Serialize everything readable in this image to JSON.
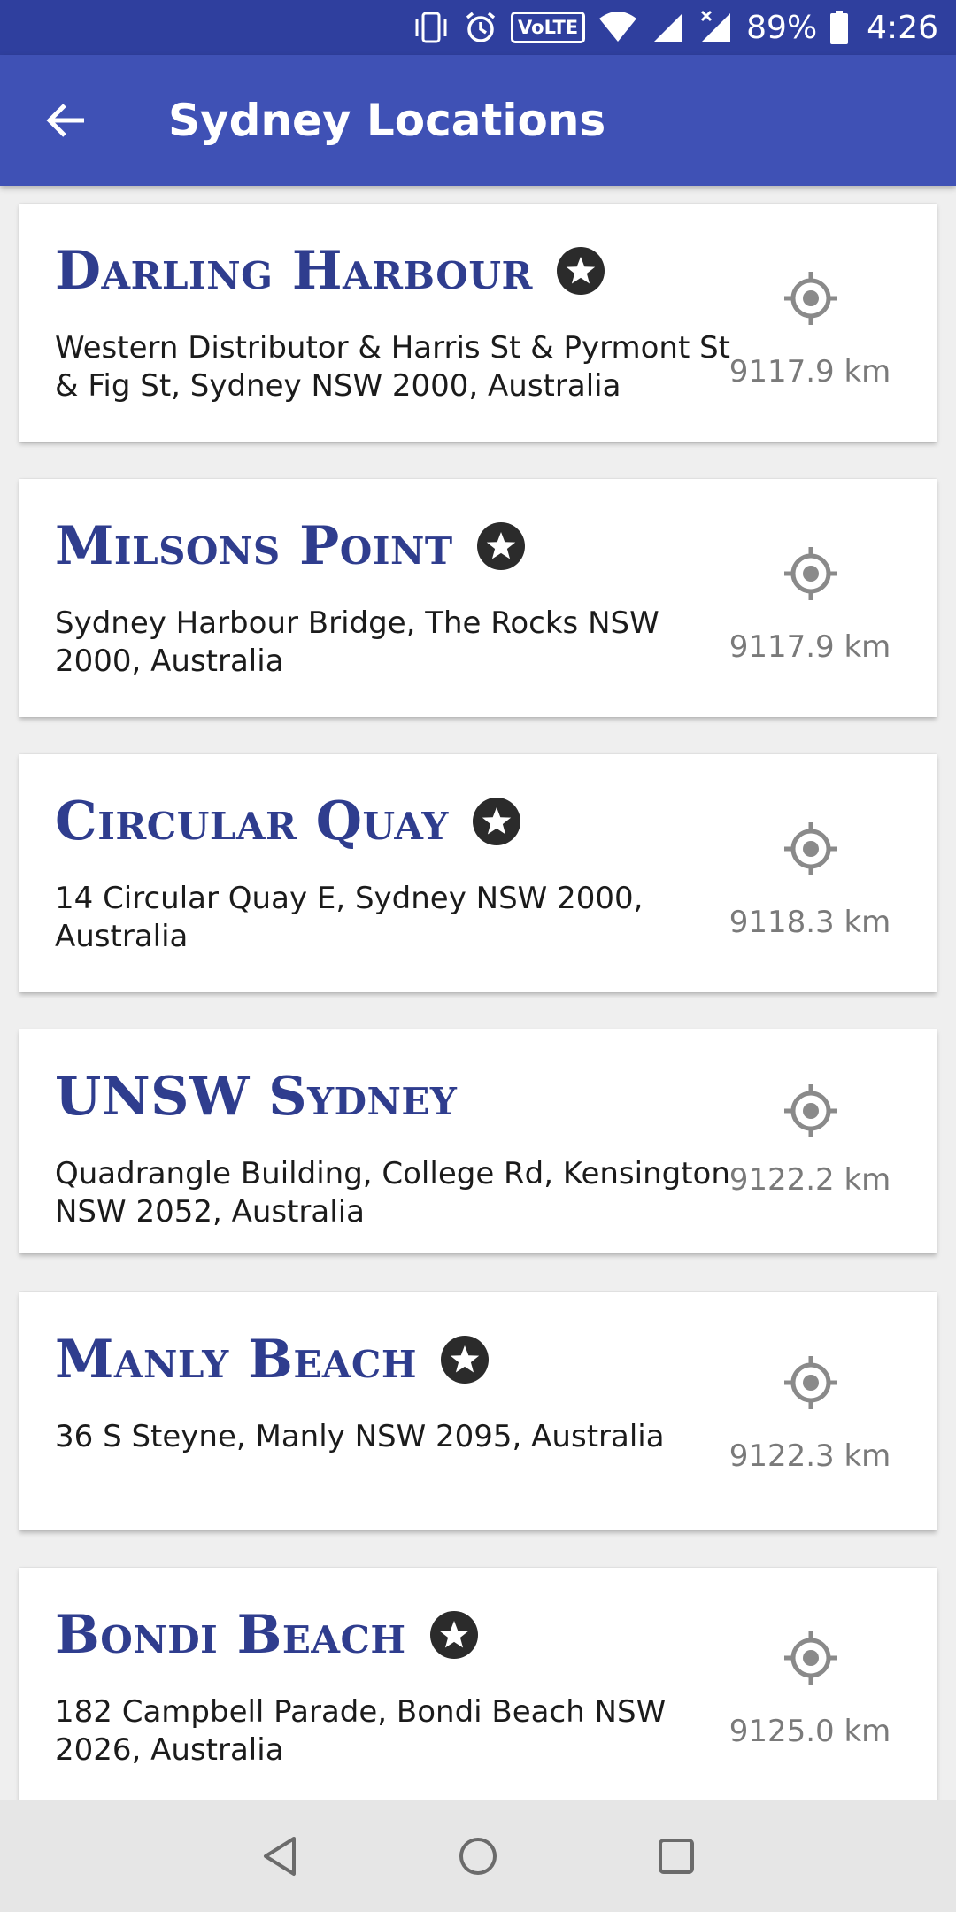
{
  "status_bar": {
    "network_label": "VoLTE",
    "battery": "89%",
    "time": "4:26",
    "icons": [
      "vibrate-icon",
      "alarm-icon",
      "volte-icon",
      "wifi-icon",
      "signal-icon",
      "signal-no-data-icon",
      "battery-icon"
    ]
  },
  "app_bar": {
    "title": "Sydney Locations",
    "back_icon": "arrow-back-icon",
    "color": "#3f51b5",
    "status_color": "#2f3f9e"
  },
  "locations": [
    {
      "name": "Darling Harbour",
      "favorite": true,
      "address": "Western Distributor & Harris St & Pyrmont St & Fig St, Sydney NSW 2000, Australia",
      "distance": "9117.9 km"
    },
    {
      "name": "Milsons Point",
      "favorite": true,
      "address": "Sydney Harbour Bridge, The Rocks NSW 2000, Australia",
      "distance": "9117.9 km"
    },
    {
      "name": "Circular Quay",
      "favorite": true,
      "address": "14 Circular Quay E, Sydney NSW 2000, Australia",
      "distance": "9118.3 km"
    },
    {
      "name": "UNSW Sydney",
      "favorite": false,
      "address": "Quadrangle Building, College Rd, Kensington NSW 2052, Australia",
      "distance": "9122.2 km"
    },
    {
      "name": "Manly Beach",
      "favorite": true,
      "address": "36 S Steyne, Manly NSW 2095, Australia",
      "distance": "9122.3 km"
    },
    {
      "name": "Bondi Beach",
      "favorite": true,
      "address": "182 Campbell Parade, Bondi Beach NSW 2026, Australia",
      "distance": "9125.0 km"
    }
  ],
  "colors": {
    "title_text": "#2f3d8e",
    "distance_text": "#7a7a7a",
    "star_badge": "#2b2b2b",
    "locate_icon": "#8a8a8a"
  },
  "nav_bar": {
    "icons": [
      "nav-back-icon",
      "nav-home-icon",
      "nav-recents-icon"
    ]
  }
}
